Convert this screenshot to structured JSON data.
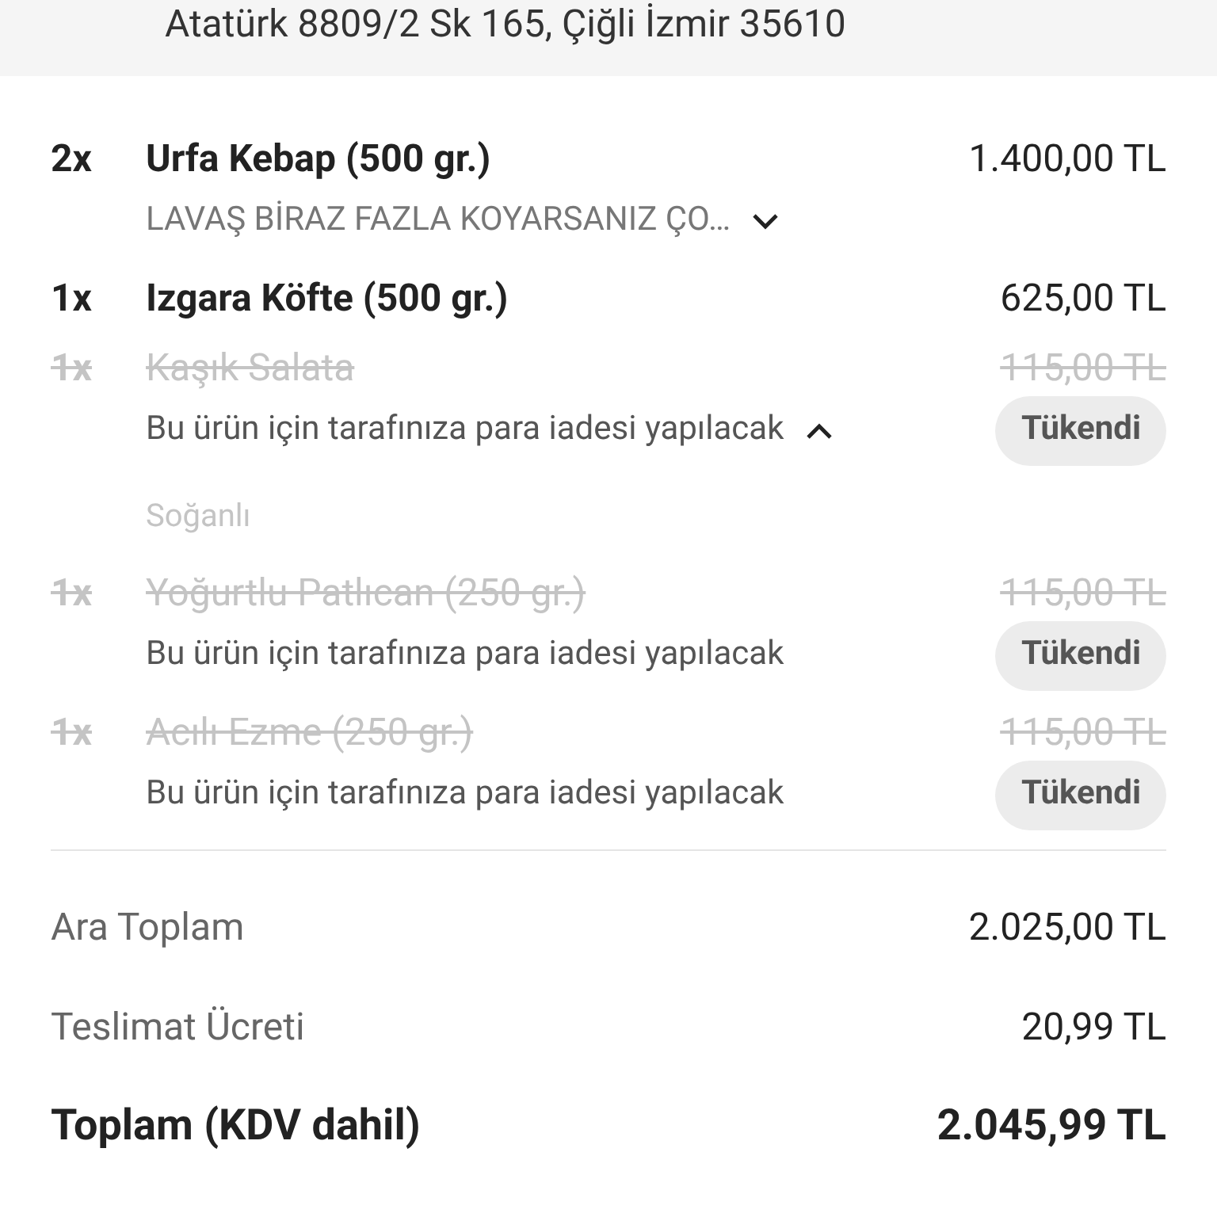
{
  "address": "Atatürk 8809/2 Sk 165, Çiğli İzmir 35610",
  "items": [
    {
      "qty": "2x",
      "name": "Urfa Kebap (500 gr.)",
      "price": "1.400,00 TL",
      "sold_out": false,
      "note": "LAVAŞ BİRAZ FAZLA KOYARSANIZ ÇO…",
      "expanded": false
    },
    {
      "qty": "1x",
      "name": "Izgara Köfte (500 gr.)",
      "price": "625,00 TL",
      "sold_out": false
    },
    {
      "qty": "1x",
      "name": "Kaşık Salata",
      "price": "115,00 TL",
      "sold_out": true,
      "note": "Bu ürün için tarafınıza para iadesi yapılacak",
      "expanded": true,
      "badge": "Tükendi",
      "options": [
        "Soğanlı"
      ]
    },
    {
      "qty": "1x",
      "name": "Yoğurtlu Patlıcan (250 gr.)",
      "price": "115,00 TL",
      "sold_out": true,
      "note": "Bu ürün için tarafınıza para iadesi yapılacak",
      "badge": "Tükendi"
    },
    {
      "qty": "1x",
      "name": "Acılı Ezme (250 gr.)",
      "price": "115,00 TL",
      "sold_out": true,
      "note": "Bu ürün için tarafınıza para iadesi yapılacak",
      "badge": "Tükendi"
    }
  ],
  "totals": [
    {
      "label": "Ara Toplam",
      "value": "2.025,00 TL",
      "kind": "line"
    },
    {
      "label": "Teslimat Ücreti",
      "value": "20,99 TL",
      "kind": "line"
    },
    {
      "label": "Toplam (KDV dahil)",
      "value": "2.045,99 TL",
      "kind": "grand"
    }
  ]
}
